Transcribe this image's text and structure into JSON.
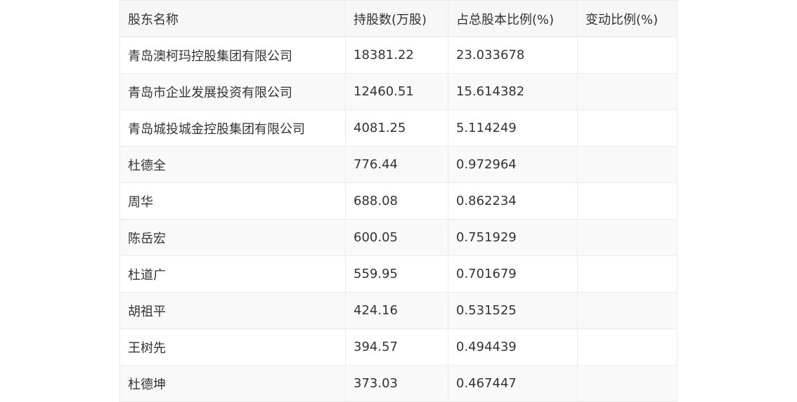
{
  "table": {
    "headers": [
      "股东名称",
      "持股数(万股)",
      "占总股本比例(%)",
      "变动比例(%)"
    ],
    "rows": [
      [
        "青岛澳柯玛控股集团有限公司",
        "18381.22",
        "23.033678",
        ""
      ],
      [
        "青岛市企业发展投资有限公司",
        "12460.51",
        "15.614382",
        ""
      ],
      [
        "青岛城投城金控股集团有限公司",
        "4081.25",
        "5.114249",
        ""
      ],
      [
        "杜德全",
        "776.44",
        "0.972964",
        ""
      ],
      [
        "周华",
        "688.08",
        "0.862234",
        ""
      ],
      [
        "陈岳宏",
        "600.05",
        "0.751929",
        ""
      ],
      [
        "杜道广",
        "559.95",
        "0.701679",
        ""
      ],
      [
        "胡祖平",
        "424.16",
        "0.531525",
        ""
      ],
      [
        "王树先",
        "394.57",
        "0.494439",
        ""
      ],
      [
        "杜德坤",
        "373.03",
        "0.467447",
        ""
      ]
    ]
  }
}
